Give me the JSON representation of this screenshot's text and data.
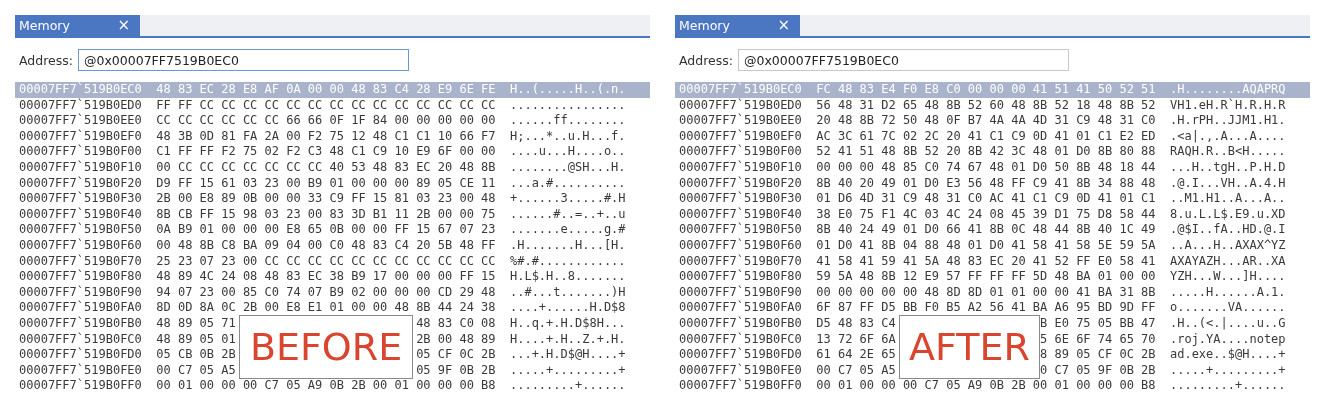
{
  "panels": [
    {
      "tab": {
        "title": "Memory",
        "close": "×",
        "selected": true
      },
      "address": {
        "label": "Address:",
        "value": "@0x00007FF7519B0EC0",
        "focused": true
      },
      "stamp": "BEFORE",
      "rows": [
        {
          "address": "00007FF7`519B0EC0",
          "bytes": [
            "48",
            "83",
            "EC",
            "28",
            "E8",
            "AF",
            "0A",
            "00",
            "00",
            "48",
            "83",
            "C4",
            "28",
            "E9",
            "6E",
            "FE"
          ],
          "ascii": "H..(.....H..(.n.",
          "selected": true
        },
        {
          "address": "00007FF7`519B0ED0",
          "bytes": [
            "FF",
            "FF",
            "CC",
            "CC",
            "CC",
            "CC",
            "CC",
            "CC",
            "CC",
            "CC",
            "CC",
            "CC",
            "CC",
            "CC",
            "CC",
            "CC"
          ],
          "ascii": "................",
          "selected": false
        },
        {
          "address": "00007FF7`519B0EE0",
          "bytes": [
            "CC",
            "CC",
            "CC",
            "CC",
            "CC",
            "CC",
            "66",
            "66",
            "0F",
            "1F",
            "84",
            "00",
            "00",
            "00",
            "00",
            "00"
          ],
          "ascii": "......ff........",
          "selected": false
        },
        {
          "address": "00007FF7`519B0EF0",
          "bytes": [
            "48",
            "3B",
            "0D",
            "81",
            "FA",
            "2A",
            "00",
            "F2",
            "75",
            "12",
            "48",
            "C1",
            "C1",
            "10",
            "66",
            "F7"
          ],
          "ascii": "H;...*..u.H...f.",
          "selected": false
        },
        {
          "address": "00007FF7`519B0F00",
          "bytes": [
            "C1",
            "FF",
            "FF",
            "F2",
            "75",
            "02",
            "F2",
            "C3",
            "48",
            "C1",
            "C9",
            "10",
            "E9",
            "6F",
            "00",
            "00"
          ],
          "ascii": "....u...H....o..",
          "selected": false
        },
        {
          "address": "00007FF7`519B0F10",
          "bytes": [
            "00",
            "CC",
            "CC",
            "CC",
            "CC",
            "CC",
            "CC",
            "CC",
            "40",
            "53",
            "48",
            "83",
            "EC",
            "20",
            "48",
            "8B"
          ],
          "ascii": "........@SH...H.",
          "selected": false
        },
        {
          "address": "00007FF7`519B0F20",
          "bytes": [
            "D9",
            "FF",
            "15",
            "61",
            "03",
            "23",
            "00",
            "B9",
            "01",
            "00",
            "00",
            "00",
            "89",
            "05",
            "CE",
            "11"
          ],
          "ascii": "...a.#..........",
          "selected": false
        },
        {
          "address": "00007FF7`519B0F30",
          "bytes": [
            "2B",
            "00",
            "E8",
            "89",
            "0B",
            "00",
            "00",
            "33",
            "C9",
            "FF",
            "15",
            "81",
            "03",
            "23",
            "00",
            "48"
          ],
          "ascii": "+......3.....#.H",
          "selected": false
        },
        {
          "address": "00007FF7`519B0F40",
          "bytes": [
            "8B",
            "CB",
            "FF",
            "15",
            "98",
            "03",
            "23",
            "00",
            "83",
            "3D",
            "B1",
            "11",
            "2B",
            "00",
            "00",
            "75"
          ],
          "ascii": "......#..=..+..u",
          "selected": false
        },
        {
          "address": "00007FF7`519B0F50",
          "bytes": [
            "0A",
            "B9",
            "01",
            "00",
            "00",
            "00",
            "E8",
            "65",
            "0B",
            "00",
            "00",
            "FF",
            "15",
            "67",
            "07",
            "23"
          ],
          "ascii": ".......e.....g.#",
          "selected": false
        },
        {
          "address": "00007FF7`519B0F60",
          "bytes": [
            "00",
            "48",
            "8B",
            "C8",
            "BA",
            "09",
            "04",
            "00",
            "C0",
            "48",
            "83",
            "C4",
            "20",
            "5B",
            "48",
            "FF"
          ],
          "ascii": ".H.......H...[H.",
          "selected": false
        },
        {
          "address": "00007FF7`519B0F70",
          "bytes": [
            "25",
            "23",
            "07",
            "23",
            "00",
            "CC",
            "CC",
            "CC",
            "CC",
            "CC",
            "CC",
            "CC",
            "CC",
            "CC",
            "CC",
            "CC"
          ],
          "ascii": "%#.#............",
          "selected": false
        },
        {
          "address": "00007FF7`519B0F80",
          "bytes": [
            "48",
            "89",
            "4C",
            "24",
            "08",
            "48",
            "83",
            "EC",
            "38",
            "B9",
            "17",
            "00",
            "00",
            "00",
            "FF",
            "15"
          ],
          "ascii": "H.L$.H..8.......",
          "selected": false
        },
        {
          "address": "00007FF7`519B0F90",
          "bytes": [
            "94",
            "07",
            "23",
            "00",
            "85",
            "C0",
            "74",
            "07",
            "B9",
            "02",
            "00",
            "00",
            "00",
            "CD",
            "29",
            "48"
          ],
          "ascii": "..#...t.......)H",
          "selected": false
        },
        {
          "address": "00007FF7`519B0FA0",
          "bytes": [
            "8D",
            "0D",
            "8A",
            "0C",
            "2B",
            "00",
            "E8",
            "E1",
            "01",
            "00",
            "00",
            "48",
            "8B",
            "44",
            "24",
            "38"
          ],
          "ascii": "....+......H.D$8",
          "selected": false
        },
        {
          "address": "00007FF7`519B0FB0",
          "bytes": [
            "48",
            "89",
            "05",
            "71"
          ],
          "bytes_after_cover": [
            "48",
            "83",
            "C0",
            "08"
          ],
          "ascii": "H..q.+.H.D$8H...",
          "selected": false
        },
        {
          "address": "00007FF7`519B0FC0",
          "bytes": [
            "48",
            "89",
            "05",
            "01"
          ],
          "bytes_after_cover": [
            "2B",
            "00",
            "48",
            "89"
          ],
          "ascii": "H....+.H..Z.+.H.",
          "selected": false
        },
        {
          "address": "00007FF7`519B0FD0",
          "bytes": [
            "05",
            "CB",
            "0B",
            "2B"
          ],
          "bytes_after_cover": [
            "05",
            "CF",
            "0C",
            "2B"
          ],
          "ascii": "...+.H.D$@H....+",
          "selected": false
        },
        {
          "address": "00007FF7`519B0FE0",
          "bytes": [
            "00",
            "C7",
            "05",
            "A5"
          ],
          "bytes_after_cover": [
            "05",
            "9F",
            "0B",
            "2B"
          ],
          "ascii": ".....+.........+",
          "selected": false
        },
        {
          "address": "00007FF7`519B0FF0",
          "bytes": [
            "00",
            "01",
            "00",
            "00",
            "00",
            "C7",
            "05",
            "A9",
            "0B",
            "2B",
            "00",
            "01",
            "00",
            "00",
            "00",
            "B8"
          ],
          "ascii": ".........+......",
          "selected": false
        }
      ]
    },
    {
      "tab": {
        "title": "Memory",
        "close": "×",
        "selected": true
      },
      "address": {
        "label": "Address:",
        "value": "@0x00007FF7519B0EC0",
        "focused": false
      },
      "stamp": "AFTER",
      "rows": [
        {
          "address": "00007FF7`519B0EC0",
          "bytes": [
            "FC",
            "48",
            "83",
            "E4",
            "F0",
            "E8",
            "C0",
            "00",
            "00",
            "00",
            "41",
            "51",
            "41",
            "50",
            "52",
            "51"
          ],
          "ascii": ".H........AQAPRQ",
          "selected": true
        },
        {
          "address": "00007FF7`519B0ED0",
          "bytes": [
            "56",
            "48",
            "31",
            "D2",
            "65",
            "48",
            "8B",
            "52",
            "60",
            "48",
            "8B",
            "52",
            "18",
            "48",
            "8B",
            "52"
          ],
          "ascii": "VH1.eH.R`H.R.H.R",
          "selected": false
        },
        {
          "address": "00007FF7`519B0EE0",
          "bytes": [
            "20",
            "48",
            "8B",
            "72",
            "50",
            "48",
            "0F",
            "B7",
            "4A",
            "4A",
            "4D",
            "31",
            "C9",
            "48",
            "31",
            "C0"
          ],
          "ascii": ".H.rPH..JJM1.H1.",
          "selected": false
        },
        {
          "address": "00007FF7`519B0EF0",
          "bytes": [
            "AC",
            "3C",
            "61",
            "7C",
            "02",
            "2C",
            "20",
            "41",
            "C1",
            "C9",
            "0D",
            "41",
            "01",
            "C1",
            "E2",
            "ED"
          ],
          "ascii": ".<a|.,.A...A....",
          "selected": false
        },
        {
          "address": "00007FF7`519B0F00",
          "bytes": [
            "52",
            "41",
            "51",
            "48",
            "8B",
            "52",
            "20",
            "8B",
            "42",
            "3C",
            "48",
            "01",
            "D0",
            "8B",
            "80",
            "88"
          ],
          "ascii": "RAQH.R..B<H.....",
          "selected": false
        },
        {
          "address": "00007FF7`519B0F10",
          "bytes": [
            "00",
            "00",
            "00",
            "48",
            "85",
            "C0",
            "74",
            "67",
            "48",
            "01",
            "D0",
            "50",
            "8B",
            "48",
            "18",
            "44"
          ],
          "ascii": "...H..tgH..P.H.D",
          "selected": false
        },
        {
          "address": "00007FF7`519B0F20",
          "bytes": [
            "8B",
            "40",
            "20",
            "49",
            "01",
            "D0",
            "E3",
            "56",
            "48",
            "FF",
            "C9",
            "41",
            "8B",
            "34",
            "88",
            "48"
          ],
          "ascii": ".@.I...VH..A.4.H",
          "selected": false
        },
        {
          "address": "00007FF7`519B0F30",
          "bytes": [
            "01",
            "D6",
            "4D",
            "31",
            "C9",
            "48",
            "31",
            "C0",
            "AC",
            "41",
            "C1",
            "C9",
            "0D",
            "41",
            "01",
            "C1"
          ],
          "ascii": "..M1.H1..A...A..",
          "selected": false
        },
        {
          "address": "00007FF7`519B0F40",
          "bytes": [
            "38",
            "E0",
            "75",
            "F1",
            "4C",
            "03",
            "4C",
            "24",
            "08",
            "45",
            "39",
            "D1",
            "75",
            "D8",
            "58",
            "44"
          ],
          "ascii": "8.u.L.L$.E9.u.XD",
          "selected": false
        },
        {
          "address": "00007FF7`519B0F50",
          "bytes": [
            "8B",
            "40",
            "24",
            "49",
            "01",
            "D0",
            "66",
            "41",
            "8B",
            "0C",
            "48",
            "44",
            "8B",
            "40",
            "1C",
            "49"
          ],
          "ascii": ".@$I..fA..HD.@.I",
          "selected": false
        },
        {
          "address": "00007FF7`519B0F60",
          "bytes": [
            "01",
            "D0",
            "41",
            "8B",
            "04",
            "88",
            "48",
            "01",
            "D0",
            "41",
            "58",
            "41",
            "58",
            "5E",
            "59",
            "5A"
          ],
          "ascii": "..A...H..AXAX^YZ",
          "selected": false
        },
        {
          "address": "00007FF7`519B0F70",
          "bytes": [
            "41",
            "58",
            "41",
            "59",
            "41",
            "5A",
            "48",
            "83",
            "EC",
            "20",
            "41",
            "52",
            "FF",
            "E0",
            "58",
            "41"
          ],
          "ascii": "AXAYAZH...AR..XA",
          "selected": false
        },
        {
          "address": "00007FF7`519B0F80",
          "bytes": [
            "59",
            "5A",
            "48",
            "8B",
            "12",
            "E9",
            "57",
            "FF",
            "FF",
            "FF",
            "5D",
            "48",
            "BA",
            "01",
            "00",
            "00"
          ],
          "ascii": "YZH...W...]H....",
          "selected": false
        },
        {
          "address": "00007FF7`519B0F90",
          "bytes": [
            "00",
            "00",
            "00",
            "00",
            "00",
            "48",
            "8D",
            "8D",
            "01",
            "01",
            "00",
            "00",
            "41",
            "BA",
            "31",
            "8B"
          ],
          "ascii": ".....H......A.1.",
          "selected": false
        },
        {
          "address": "00007FF7`519B0FA0",
          "bytes": [
            "6F",
            "87",
            "FF",
            "D5",
            "BB",
            "F0",
            "B5",
            "A2",
            "56",
            "41",
            "BA",
            "A6",
            "95",
            "BD",
            "9D",
            "FF"
          ],
          "ascii": "o.......VA......",
          "selected": false
        },
        {
          "address": "00007FF7`519B0FB0",
          "bytes": [
            "D5",
            "48",
            "83",
            "C4"
          ],
          "bytes_after_cover": [
            "B",
            "E0",
            "75",
            "05",
            "BB",
            "47"
          ],
          "ascii": ".H..(<.|....u..G",
          "selected": false
        },
        {
          "address": "00007FF7`519B0FC0",
          "bytes": [
            "13",
            "72",
            "6F",
            "6A"
          ],
          "bytes_after_cover": [
            "5",
            "6E",
            "6F",
            "74",
            "65",
            "70"
          ],
          "ascii": ".roj.YA....notep",
          "selected": false
        },
        {
          "address": "00007FF7`519B0FD0",
          "bytes": [
            "61",
            "64",
            "2E",
            "65"
          ],
          "bytes_after_cover": [
            "8",
            "89",
            "05",
            "CF",
            "0C",
            "2B"
          ],
          "ascii": "ad.exe..$@H....+",
          "selected": false
        },
        {
          "address": "00007FF7`519B0FE0",
          "bytes": [
            "00",
            "C7",
            "05",
            "A5"
          ],
          "bytes_after_cover": [
            "0",
            "C7",
            "05",
            "9F",
            "0B",
            "2B"
          ],
          "ascii": ".....+.........+",
          "selected": false
        },
        {
          "address": "00007FF7`519B0FF0",
          "bytes": [
            "00",
            "01",
            "00",
            "00",
            "00",
            "C7",
            "05",
            "A9",
            "0B",
            "2B",
            "00",
            "01",
            "00",
            "00",
            "00",
            "B8"
          ],
          "ascii": ".........+......",
          "selected": false
        }
      ]
    }
  ]
}
